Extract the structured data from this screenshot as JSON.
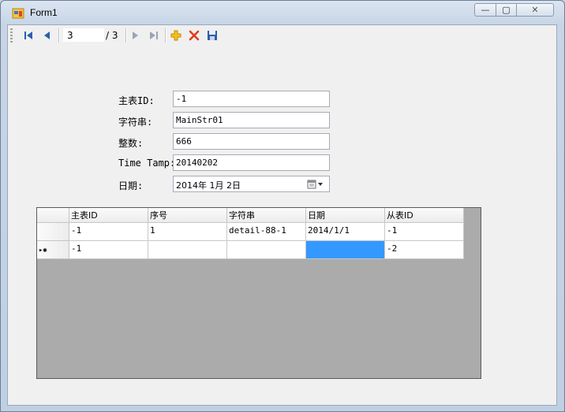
{
  "window": {
    "title": "Form1",
    "caption_buttons": {
      "minimize": "—",
      "maximize": "▢",
      "close": "✕"
    }
  },
  "toolbar": {
    "position_value": "3",
    "count_label": "/ 3",
    "icons": [
      "move-first-icon",
      "move-previous-icon",
      "move-next-icon",
      "move-last-icon",
      "add-new-icon",
      "delete-icon",
      "save-icon"
    ]
  },
  "form": {
    "main_id_label": "主表ID:",
    "main_id_value": "-1",
    "string_label": "字符串:",
    "string_value": "MainStr01",
    "integer_label": "整数:",
    "integer_value": "666",
    "timestamp_label": "Time Tamp:",
    "timestamp_value": "20140202",
    "date_label": "日期:",
    "date_value": "2014年  1月  2日"
  },
  "grid": {
    "columns": [
      "主表ID",
      "序号",
      "字符串",
      "日期",
      "从表ID"
    ],
    "rows": [
      [
        "-1",
        "1",
        "detail-88-1",
        "2014/1/1",
        "-1"
      ],
      [
        "-1",
        "",
        "",
        "",
        "-2"
      ]
    ],
    "new_row_indicator": "▸✱"
  },
  "colors": {
    "selection": "#3399ff",
    "grid_background": "#ababab",
    "delete_icon": "#e03c1e",
    "add_icon": "#e6a000",
    "nav_icon": "#2a5fb0"
  }
}
